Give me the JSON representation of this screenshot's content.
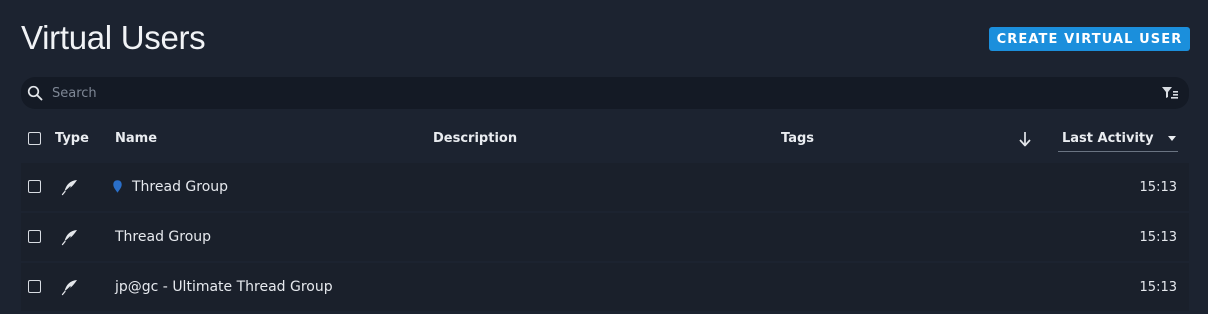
{
  "page": {
    "title": "Virtual Users",
    "create_button_label": "CREATE VIRTUAL USER"
  },
  "search": {
    "placeholder": "Search",
    "value": ""
  },
  "table": {
    "columns": {
      "type": "Type",
      "name": "Name",
      "description": "Description",
      "tags": "Tags"
    },
    "sort": {
      "field": "Last Activity",
      "direction": "descending"
    },
    "rows": [
      {
        "type_icon": "feather-icon",
        "tag_marker": "blue",
        "name": "Thread Group",
        "description": "",
        "tags": "",
        "last_activity": "15:13"
      },
      {
        "type_icon": "feather-icon",
        "tag_marker": null,
        "name": "Thread Group",
        "description": "",
        "tags": "",
        "last_activity": "15:13"
      },
      {
        "type_icon": "feather-icon",
        "tag_marker": null,
        "name": "jp@gc - Ultimate Thread Group",
        "description": "",
        "tags": "",
        "last_activity": "15:13"
      }
    ]
  },
  "colors": {
    "background": "#1c2330",
    "accent": "#1b8fdc",
    "tag_blue": "#2a6fc9"
  }
}
